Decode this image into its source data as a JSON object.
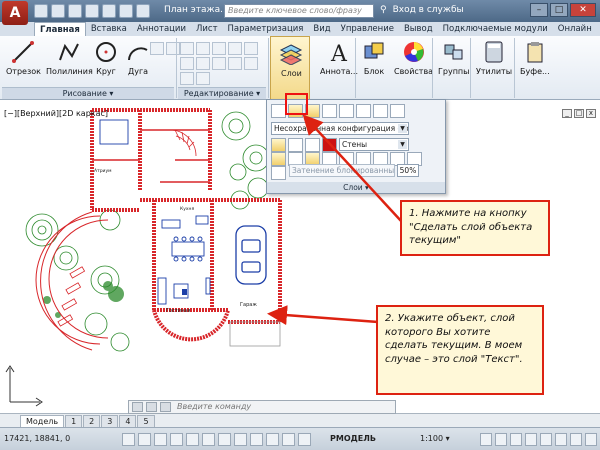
{
  "titlebar": {
    "app_letter": "A",
    "doc_title": "План этажа...",
    "search_placeholder": "Введите ключевое слово/фразу",
    "signin": "Вход в службы",
    "win_min": "–",
    "win_max": "□",
    "win_close": "✕"
  },
  "tabs": [
    "Главная",
    "Вставка",
    "Аннотации",
    "Лист",
    "Параметризация",
    "Вид",
    "Управление",
    "Вывод",
    "Подключаемые модули",
    "Онлайн"
  ],
  "ribbon": {
    "draw_tools": [
      "Отрезок",
      "Полилиния",
      "Круг",
      "Дуга"
    ],
    "draw_group": "Рисование ▾",
    "modify_group": "Редактирование ▾",
    "layers": "Слои",
    "annotation": "Аннота...",
    "block": "Блок",
    "properties": "Свойства",
    "groups": "Группы",
    "utilities": "Утилиты",
    "clipboard": "Буфе..."
  },
  "viewport": {
    "label": "[−][Верхний][2D каркас]",
    "ctl_min": "_",
    "ctl_max": "□",
    "ctl_close": "x"
  },
  "layer_panel": {
    "state_combo": "Несохраненная конфигурация сло",
    "current_layer": "Стены",
    "lock_fade": "Затенение блокированных с...",
    "fade_percent": "50%",
    "footer": "Слои ▾"
  },
  "plan_labels": {
    "garage": "Гараж",
    "living": "Гостиная",
    "kitchen": "Кухня",
    "atrium": "Атриум"
  },
  "callouts": {
    "one": "1. Нажмите на кнопку \"Сделать слой объекта текущим\"",
    "two": "2. Укажите объект, слой которого Вы хотите сделать текущим. В моем случае – это слой \"Текст\"."
  },
  "command_line": {
    "placeholder": "Введите команду"
  },
  "layout_tabs": [
    "Модель",
    "1",
    "2",
    "3",
    "4",
    "5"
  ],
  "status": {
    "coords": "17421, 18841, 0",
    "model": "РМОДЕЛЬ",
    "scale": "1:100 ▾"
  },
  "colors": {
    "app_red": "#c0392b",
    "wall_red": "#d8262a",
    "callout_border": "#d21111",
    "callout_fill": "#fff8d8",
    "tree_green": "#2c8a2c",
    "car_blue": "#1c3fa8"
  }
}
